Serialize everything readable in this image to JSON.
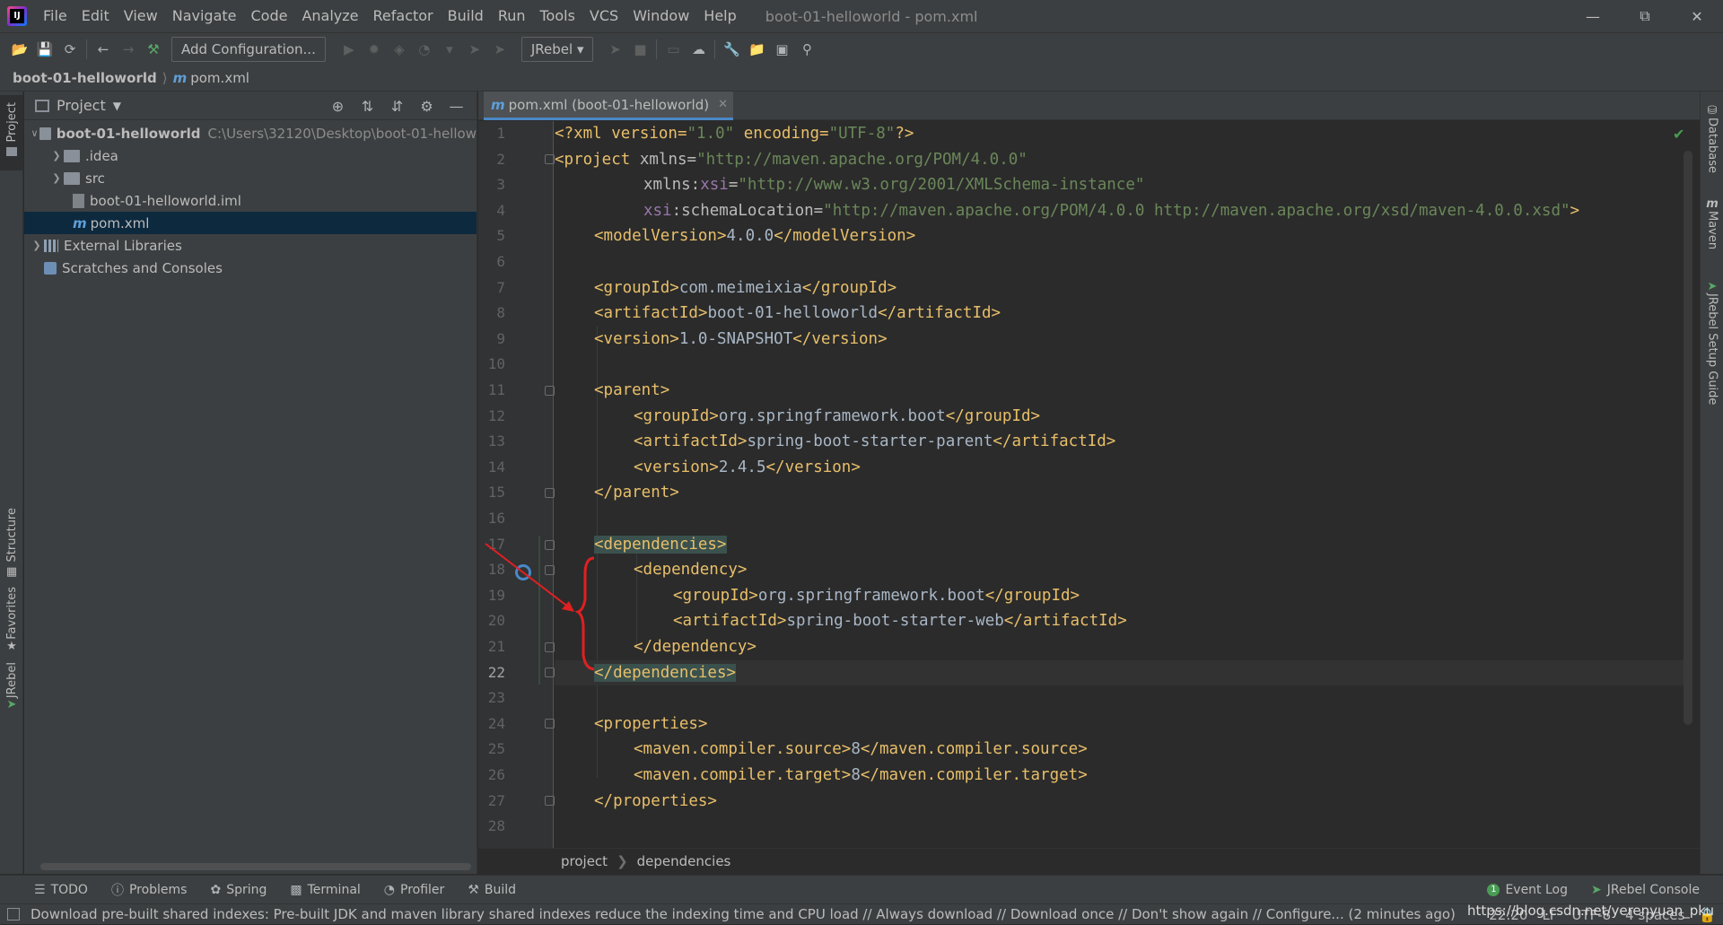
{
  "menubar": {
    "items": [
      "File",
      "Edit",
      "View",
      "Navigate",
      "Code",
      "Analyze",
      "Refactor",
      "Build",
      "Run",
      "Tools",
      "VCS",
      "Window",
      "Help"
    ],
    "window_title": "boot-01-helloworld - pom.xml"
  },
  "toolbar": {
    "add_config_label": "Add Configuration...",
    "jrebel_label": "JRebel"
  },
  "navbar": {
    "project": "boot-01-helloworld",
    "file": "pom.xml"
  },
  "left_tabs": {
    "project": "Project",
    "structure": "Structure",
    "favorites": "Favorites",
    "jrebel": "JRebel"
  },
  "right_tabs": {
    "database": "Database",
    "maven": "Maven",
    "jrebel_guide": "JRebel Setup Guide"
  },
  "project_panel": {
    "title": "Project",
    "tree": [
      {
        "label": "boot-01-helloworld",
        "hint": "C:\\Users\\32120\\Desktop\\boot-01-hellow"
      },
      {
        "label": ".idea"
      },
      {
        "label": "src"
      },
      {
        "label": "boot-01-helloworld.iml"
      },
      {
        "label": "pom.xml"
      },
      {
        "label": "External Libraries"
      },
      {
        "label": "Scratches and Consoles"
      }
    ]
  },
  "editor": {
    "tab_label": "pom.xml (boot-01-helloworld)",
    "line_numbers": [
      "1",
      "2",
      "3",
      "4",
      "5",
      "6",
      "7",
      "8",
      "9",
      "10",
      "11",
      "12",
      "13",
      "14",
      "15",
      "16",
      "17",
      "18",
      "19",
      "20",
      "21",
      "22",
      "23",
      "24",
      "25",
      "26",
      "27",
      "28"
    ],
    "breadcrumb": [
      "project",
      "dependencies"
    ],
    "code": {
      "l1_a": "<?xml version=",
      "l1_b": "\"1.0\"",
      "l1_c": " encoding=",
      "l1_d": "\"UTF-8\"",
      "l1_e": "?>",
      "l2_a": "<project",
      "l2_b": " xmlns=",
      "l2_c": "\"http://maven.apache.org/POM/4.0.0\"",
      "l3_a": "xmlns:",
      "l3_b": "xsi",
      "l3_c": "=",
      "l3_d": "\"http://www.w3.org/2001/XMLSchema-instance\"",
      "l4_a": "xsi",
      "l4_b": ":schemaLocation=",
      "l4_c": "\"http://maven.apache.org/POM/4.0.0 http://maven.apache.org/xsd/maven-4.0.0.xsd\"",
      "l4_d": ">",
      "l5_open": "<modelVersion>",
      "l5_val": "4.0.0",
      "l5_close": "</modelVersion>",
      "l7_open": "<groupId>",
      "l7_val": "com.meimeixia",
      "l7_close": "</groupId>",
      "l8_open": "<artifactId>",
      "l8_val": "boot-01-helloworld",
      "l8_close": "</artifactId>",
      "l9_open": "<version>",
      "l9_val": "1.0-SNAPSHOT",
      "l9_close": "</version>",
      "l11": "<parent>",
      "l12_open": "<groupId>",
      "l12_val": "org.springframework.boot",
      "l12_close": "</groupId>",
      "l13_open": "<artifactId>",
      "l13_val": "spring-boot-starter-parent",
      "l13_close": "</artifactId>",
      "l14_open": "<version>",
      "l14_val": "2.4.5",
      "l14_close": "</version>",
      "l15": "</parent>",
      "l17": "<dependencies>",
      "l18": "<dependency>",
      "l19_open": "<groupId>",
      "l19_val": "org.springframework.boot",
      "l19_close": "</groupId>",
      "l20_open": "<artifactId>",
      "l20_val": "spring-boot-starter-web",
      "l20_close": "</artifactId>",
      "l21": "</dependency>",
      "l22": "</dependencies>",
      "l24": "<properties>",
      "l25_open": "<maven.compiler.source>",
      "l25_val": "8",
      "l25_close": "</maven.compiler.source>",
      "l26_open": "<maven.compiler.target>",
      "l26_val": "8",
      "l26_close": "</maven.compiler.target>",
      "l27": "</properties>"
    }
  },
  "bottom_tools": {
    "todo": "TODO",
    "problems": "Problems",
    "spring": "Spring",
    "terminal": "Terminal",
    "profiler": "Profiler",
    "build": "Build",
    "event_log": "Event Log",
    "event_log_count": "1",
    "jrebel_console": "JRebel Console"
  },
  "status": {
    "message": "Download pre-built shared indexes: Pre-built JDK and maven library shared indexes reduce the indexing time and CPU load // Always download // Download once // Don't show again // Configure... (2 minutes ago)",
    "position": "22:20",
    "line_sep": "LF",
    "encoding": "UTF-8",
    "indent": "4 spaces",
    "watermark": "https://blog.csdn.net/yerenyuan_pku"
  },
  "colors": {
    "tag": "#e8bf6a",
    "string": "#6a8759",
    "text": "#a9b7c6",
    "namespace": "#9876aa",
    "selection": "#0d293e",
    "annotation_red": "#e02020"
  }
}
